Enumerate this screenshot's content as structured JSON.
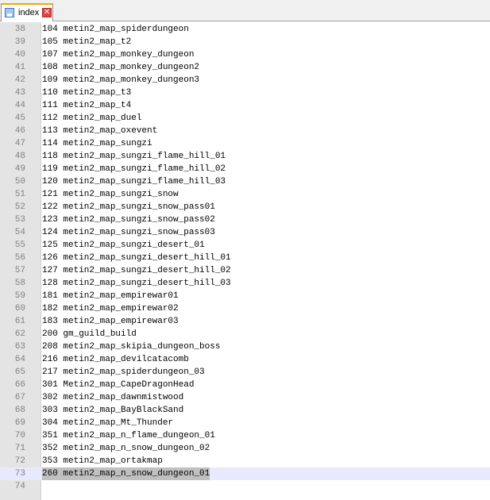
{
  "tab": {
    "label": "index",
    "close_symbol": "✕"
  },
  "editor": {
    "lines": [
      {
        "num": "38",
        "text": "104 metin2_map_spiderdungeon"
      },
      {
        "num": "39",
        "text": "105 metin2_map_t2"
      },
      {
        "num": "40",
        "text": "107 metin2_map_monkey_dungeon"
      },
      {
        "num": "41",
        "text": "108 metin2_map_monkey_dungeon2"
      },
      {
        "num": "42",
        "text": "109 metin2_map_monkey_dungeon3"
      },
      {
        "num": "43",
        "text": "110 metin2_map_t3"
      },
      {
        "num": "44",
        "text": "111 metin2_map_t4"
      },
      {
        "num": "45",
        "text": "112 metin2_map_duel"
      },
      {
        "num": "46",
        "text": "113 metin2_map_oxevent"
      },
      {
        "num": "47",
        "text": "114 metin2_map_sungzi"
      },
      {
        "num": "48",
        "text": "118 metin2_map_sungzi_flame_hill_01"
      },
      {
        "num": "49",
        "text": "119 metin2_map_sungzi_flame_hill_02"
      },
      {
        "num": "50",
        "text": "120 metin2_map_sungzi_flame_hill_03"
      },
      {
        "num": "51",
        "text": "121 metin2_map_sungzi_snow"
      },
      {
        "num": "52",
        "text": "122 metin2_map_sungzi_snow_pass01"
      },
      {
        "num": "53",
        "text": "123 metin2_map_sungzi_snow_pass02"
      },
      {
        "num": "54",
        "text": "124 metin2_map_sungzi_snow_pass03"
      },
      {
        "num": "55",
        "text": "125 metin2_map_sungzi_desert_01"
      },
      {
        "num": "56",
        "text": "126 metin2_map_sungzi_desert_hill_01"
      },
      {
        "num": "57",
        "text": "127 metin2_map_sungzi_desert_hill_02"
      },
      {
        "num": "58",
        "text": "128 metin2_map_sungzi_desert_hill_03"
      },
      {
        "num": "59",
        "text": "181 metin2_map_empirewar01"
      },
      {
        "num": "60",
        "text": "182 metin2_map_empirewar02"
      },
      {
        "num": "61",
        "text": "183 metin2_map_empirewar03"
      },
      {
        "num": "62",
        "text": "200 gm_guild_build"
      },
      {
        "num": "63",
        "text": "208 metin2_map_skipia_dungeon_boss"
      },
      {
        "num": "64",
        "text": "216 metin2_map_devilcatacomb"
      },
      {
        "num": "65",
        "text": "217 metin2_map_spiderdungeon_03"
      },
      {
        "num": "66",
        "text": "301 Metin2_map_CapeDragonHead"
      },
      {
        "num": "67",
        "text": "302 metin2_map_dawnmistwood"
      },
      {
        "num": "68",
        "text": "303 metin2_map_BayBlackSand"
      },
      {
        "num": "69",
        "text": "304 metin2_map_Mt_Thunder"
      },
      {
        "num": "70",
        "text": "351 metin2_map_n_flame_dungeon_01"
      },
      {
        "num": "71",
        "text": "352 metin2_map_n_snow_dungeon_02"
      },
      {
        "num": "72",
        "text": "353 metin2_map_ortakmap"
      },
      {
        "num": "73",
        "text": "260 metin2_map_n_snow_dungeon_01",
        "current": true
      },
      {
        "num": "74",
        "text": ""
      }
    ]
  }
}
